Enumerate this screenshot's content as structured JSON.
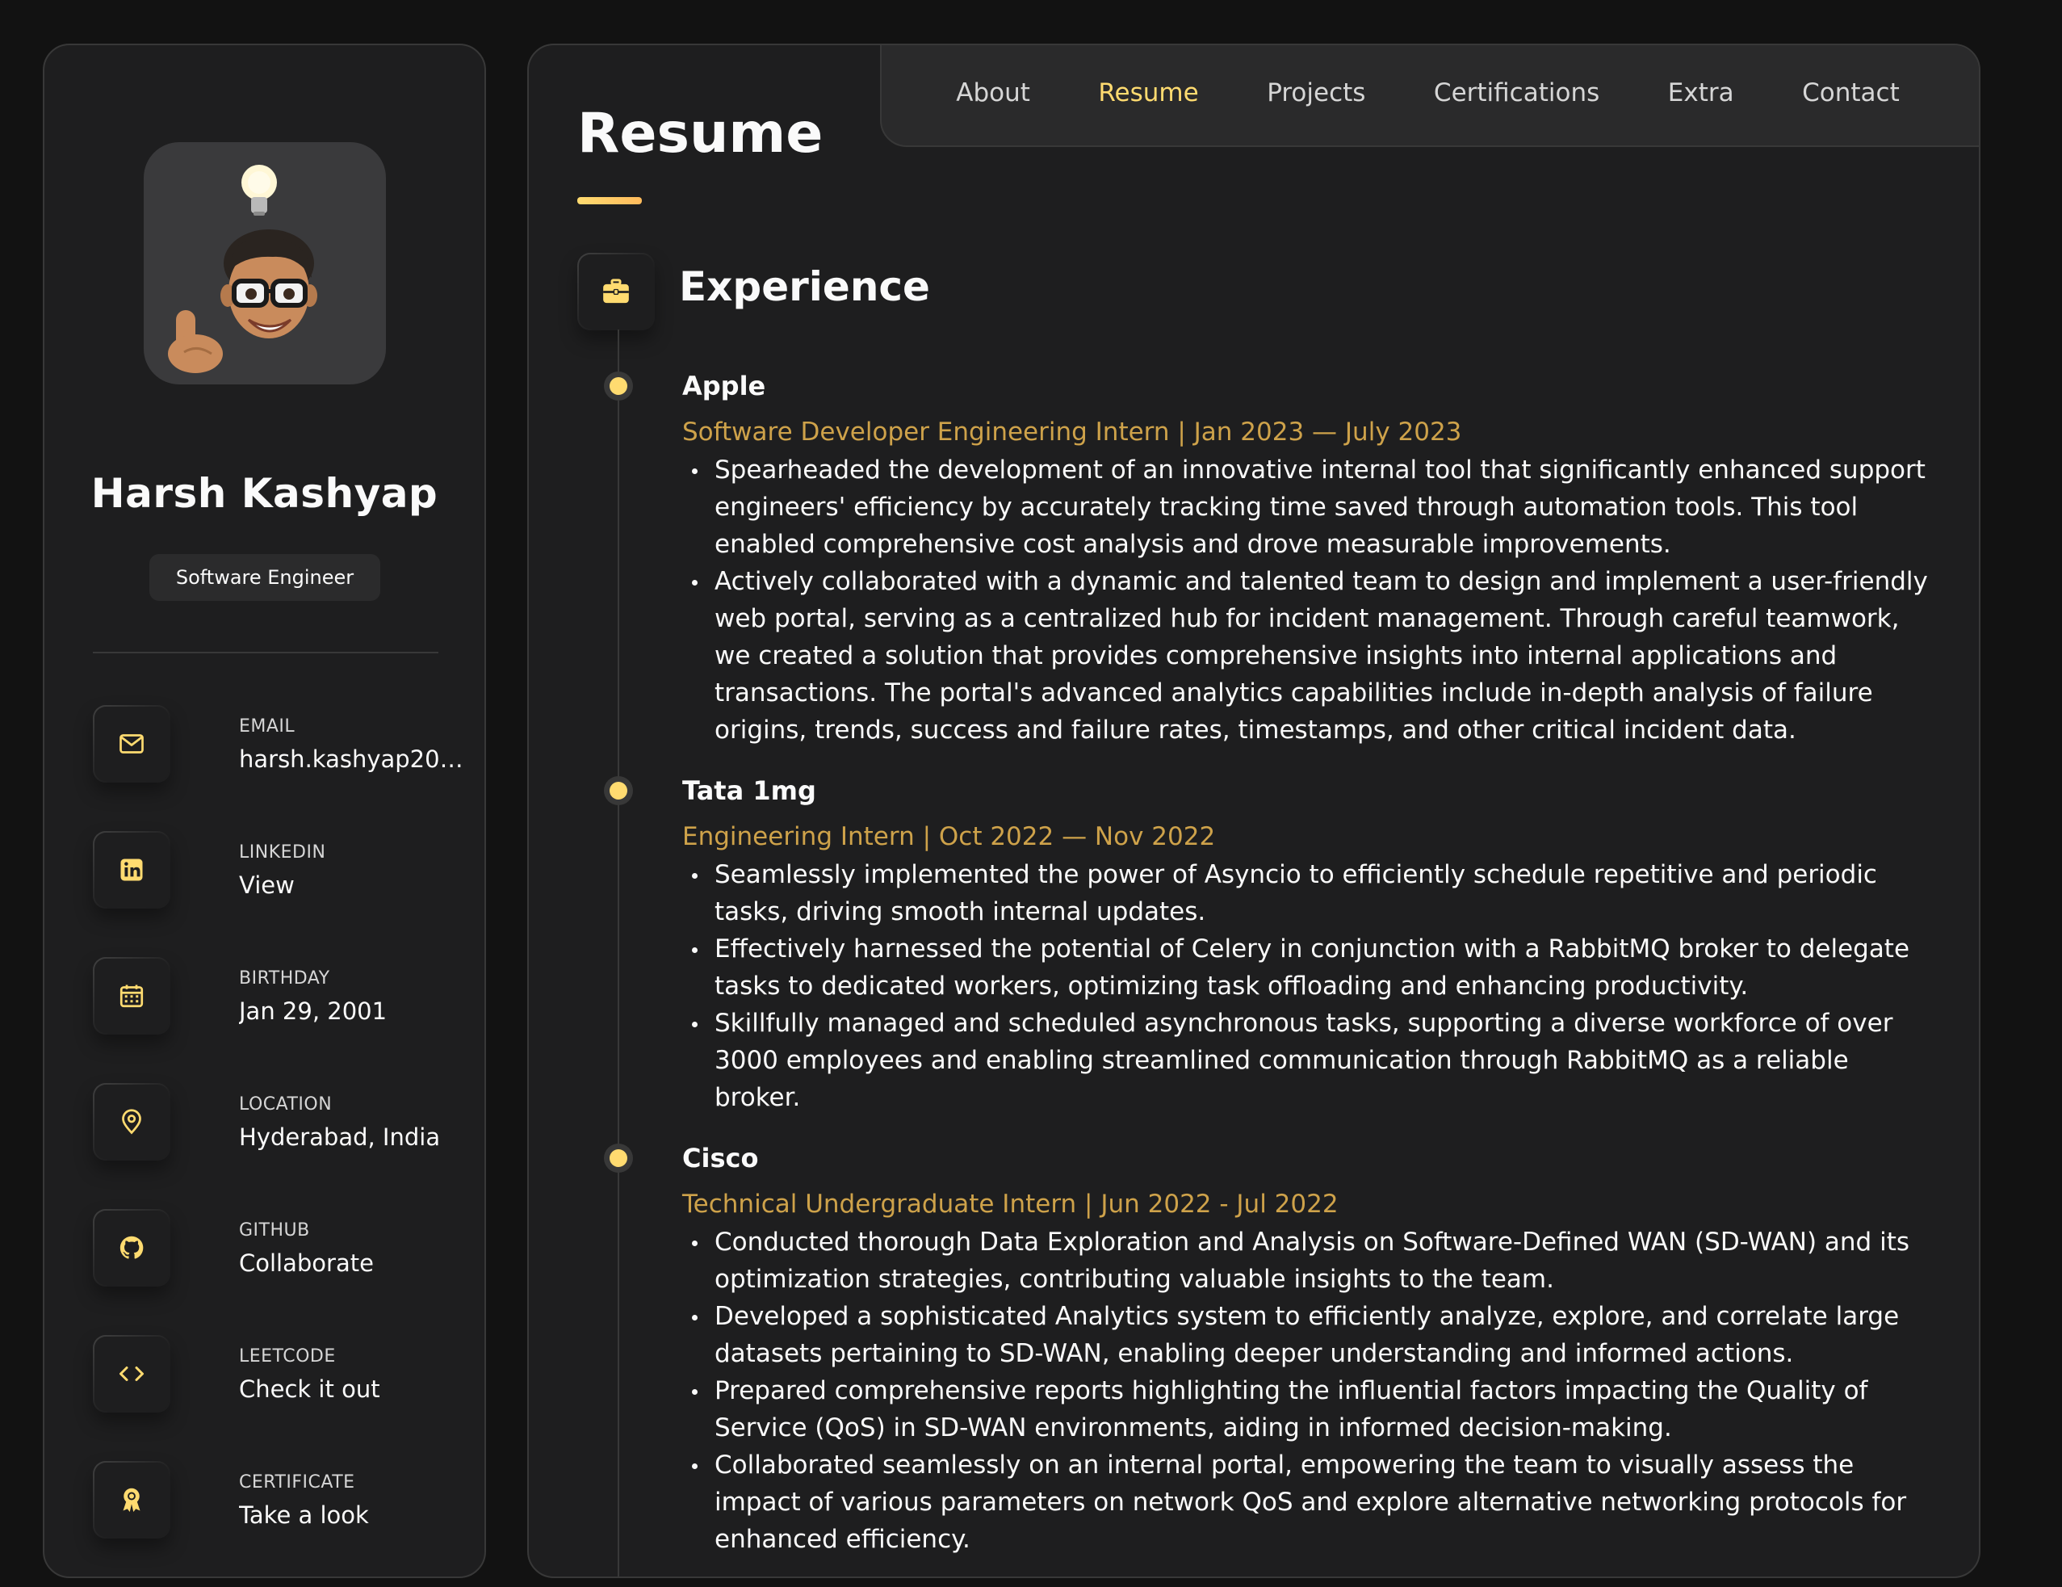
{
  "profile": {
    "name": "Harsh Kashyap",
    "title": "Software Engineer"
  },
  "contacts": [
    {
      "label": "EMAIL",
      "value": "harsh.kashyap2001...",
      "icon": "mail-icon"
    },
    {
      "label": "LINKEDIN",
      "value": "View",
      "icon": "linkedin-icon"
    },
    {
      "label": "BIRTHDAY",
      "value": "Jan 29, 2001",
      "icon": "calendar-icon"
    },
    {
      "label": "LOCATION",
      "value": "Hyderabad, India",
      "icon": "location-pin-icon"
    },
    {
      "label": "GITHUB",
      "value": "Collaborate",
      "icon": "github-icon"
    },
    {
      "label": "LEETCODE",
      "value": "Check it out",
      "icon": "code-icon"
    },
    {
      "label": "CERTIFICATE",
      "value": "Take a look",
      "icon": "award-icon"
    }
  ],
  "nav": {
    "items": [
      "About",
      "Resume",
      "Projects",
      "Certifications",
      "Extra",
      "Contact"
    ],
    "active": "Resume"
  },
  "page": {
    "title": "Resume"
  },
  "experience": {
    "title": "Experience",
    "icon": "briefcase-icon",
    "items": [
      {
        "company": "Apple",
        "role": "Software Developer Engineering Intern | Jan 2023 — July 2023",
        "points": [
          "Spearheaded the development of an innovative internal tool that significantly enhanced support engineers' efficiency by accurately tracking time saved through automation tools. This tool enabled comprehensive cost analysis and drove measurable improvements.",
          "Actively collaborated with a dynamic and talented team to design and implement a user-friendly web portal, serving as a centralized hub for incident management. Through careful teamwork, we created a solution that provides comprehensive insights into internal applications and transactions. The portal's advanced analytics capabilities include in-depth analysis of failure origins, trends, success and failure rates, timestamps, and other critical incident data."
        ]
      },
      {
        "company": "Tata 1mg",
        "role": "Engineering Intern | Oct 2022 — Nov 2022",
        "points": [
          "Seamlessly implemented the power of Asyncio to efficiently schedule repetitive and periodic tasks, driving smooth internal updates.",
          "Effectively harnessed the potential of Celery in conjunction with a RabbitMQ broker to delegate tasks to dedicated workers, optimizing task offloading and enhancing productivity.",
          "Skillfully managed and scheduled asynchronous tasks, supporting a diverse workforce of over 3000 employees and enabling streamlined communication through RabbitMQ as a reliable broker."
        ]
      },
      {
        "company": "Cisco",
        "role": "Technical Undergraduate Intern | Jun 2022 - Jul 2022",
        "points": [
          "Conducted thorough Data Exploration and Analysis on Software-Defined WAN (SD-WAN) and its optimization strategies, contributing valuable insights to the team.",
          "Developed a sophisticated Analytics system to efficiently analyze, explore, and correlate large datasets pertaining to SD-WAN, enabling deeper understanding and informed actions.",
          "Prepared comprehensive reports highlighting the influential factors impacting the Quality of Service (QoS) in SD-WAN environments, aiding in informed decision-making.",
          "Collaborated seamlessly on an internal portal, empowering the team to visually assess the impact of various parameters on network QoS and explore alternative networking protocols for enhanced efficiency."
        ]
      }
    ]
  },
  "colors": {
    "accent": "#ffdb70",
    "role_text": "#cea24a",
    "panel": "#1e1e1f",
    "background": "#121212",
    "border": "#383838"
  }
}
